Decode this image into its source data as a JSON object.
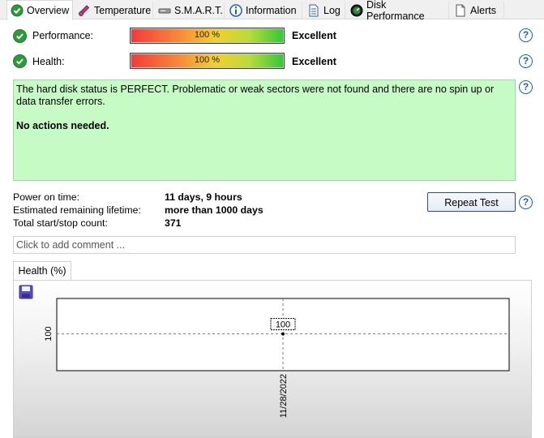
{
  "tabs": [
    {
      "label": "Overview",
      "icon": "check-circle-icon",
      "active": true
    },
    {
      "label": "Temperature",
      "icon": "thermometer-icon"
    },
    {
      "label": "S.M.A.R.T.",
      "icon": "disk-icon"
    },
    {
      "label": "Information",
      "icon": "info-icon"
    },
    {
      "label": "Log",
      "icon": "document-icon"
    },
    {
      "label": "Disk Performance",
      "icon": "gauge-icon"
    },
    {
      "label": "Alerts",
      "icon": "page-icon"
    }
  ],
  "performance": {
    "label": "Performance:",
    "value_text": "100 %",
    "rating": "Excellent",
    "percent": 100
  },
  "health": {
    "label": "Health:",
    "value_text": "100 %",
    "rating": "Excellent",
    "percent": 100
  },
  "status": {
    "message": "The hard disk status is PERFECT. Problematic or weak sectors were not found and there are no spin up or data transfer errors.",
    "action": "No actions needed."
  },
  "info": {
    "power_on_label": "Power on time:",
    "power_on_value": "11 days, 9 hours",
    "lifetime_label": "Estimated remaining lifetime:",
    "lifetime_value": "more than 1000 days",
    "startstop_label": "Total start/stop count:",
    "startstop_value": "371"
  },
  "buttons": {
    "repeat_test": "Repeat Test"
  },
  "comment": {
    "placeholder": "Click to add comment ..."
  },
  "help": "?",
  "chart_tab": "Health (%)",
  "colors": {
    "ok_green": "#2c9b3a",
    "status_bg": "#c7fbc6",
    "help_blue": "#1f5fb8"
  },
  "chart_data": {
    "type": "line",
    "x": [
      "11/28/2022"
    ],
    "series": [
      {
        "values": [
          100
        ]
      }
    ],
    "data_labels": [
      "100"
    ],
    "ytick_labels": [
      "100"
    ],
    "xtick_labels": [
      "11/28/2022"
    ],
    "title": "",
    "xlabel": "",
    "ylabel": "",
    "grid": true
  }
}
